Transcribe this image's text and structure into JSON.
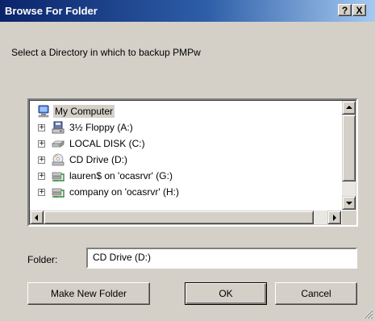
{
  "window": {
    "title": "Browse For Folder",
    "help_button": "?",
    "close_button": "X"
  },
  "prompt": "Select a Directory in which to backup PMPw",
  "tree": {
    "root": {
      "label": "My Computer",
      "icon": "my-computer-icon",
      "selected": true
    },
    "items": [
      {
        "label": "3½ Floppy (A:)",
        "icon": "floppy-drive-icon",
        "expander": "+"
      },
      {
        "label": "LOCAL DISK (C:)",
        "icon": "hard-disk-icon",
        "expander": "+"
      },
      {
        "label": "CD Drive (D:)",
        "icon": "cd-drive-icon",
        "expander": "+"
      },
      {
        "label": "lauren$ on 'ocasrvr' (G:)",
        "icon": "network-drive-icon",
        "expander": "+"
      },
      {
        "label": "company on 'ocasrvr' (H:)",
        "icon": "network-drive-icon",
        "expander": "+"
      }
    ]
  },
  "folder": {
    "label": "Folder:",
    "value": "CD Drive (D:)"
  },
  "buttons": {
    "make_new_folder": "Make New Folder",
    "ok": "OK",
    "cancel": "Cancel"
  },
  "colors": {
    "titlebar_start": "#0a246a",
    "titlebar_end": "#a6caf0",
    "face": "#d4d0c8"
  }
}
